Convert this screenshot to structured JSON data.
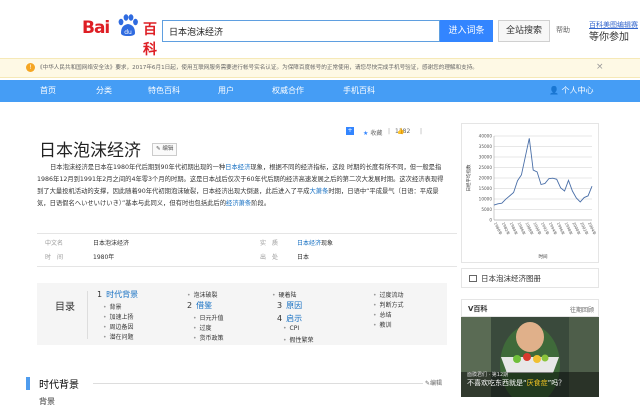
{
  "header": {
    "logo": {
      "bai": "Bai",
      "du": "du",
      "baike": "百科"
    },
    "search_value": "日本泡沫经济",
    "enter_button": "进入词条",
    "search_button": "全站搜索",
    "help": "帮助",
    "promo_line1": "百科美图编辑赛",
    "promo_line2": "等你参加"
  },
  "notice": {
    "text": "《中华人民共和国网络安全法》要求，2017年6月1日起，使用互联网服务需要进行帐号实名认证。为保障百度帐号的正常使用，请您尽快完成手机号验证，感谢您的理解和支持。",
    "close": "×"
  },
  "nav": [
    "首页",
    "分类",
    "特色百科",
    "用户",
    "权威合作",
    "手机百科"
  ],
  "nav_user": "个人中心",
  "article": {
    "title": "日本泡沫经济",
    "edit": "编辑",
    "tools": {
      "favorite": "收藏",
      "favorite_count": "1282",
      "like_count": "16",
      "share_count": "71"
    },
    "paragraph": {
      "p1": "日本泡沫经济是日本在1980年代后期到90年代初期出现的一种",
      "link1": "日本经济",
      "p2": "现象，根据不同的经济指标，这段 时期的长度有所不同，但一般是指1986年12月到1991年2月之间的4年零3个月的时期。这是日本战后仅次于60年代后期的经济高速发展之后的第二次大发展时期。这次经济表现得到了大量投机活动的支撑，因此随着90年代初期泡沫破裂，日本经济出现大倒退，此后进入了平成",
      "link2": "大萧条",
      "p3": "时期，日语中“平成景气（日语：平成景気，日语假名ヘいせいけいき）”基本与此同义，但有时也包括此后的",
      "link3": "经济萧条",
      "p4": "阶段。"
    },
    "infobox": {
      "k1": "中文名",
      "v1": "日本泡沫经济",
      "k2": "时　间",
      "v2": "1980年",
      "k3": "实　质",
      "v3_link": "日本经济",
      "v3_rest": "现象",
      "k4": "出　处",
      "v4": "日本"
    },
    "toc": {
      "title": "目录",
      "sections": [
        {
          "num": "1",
          "label": "时代背景"
        },
        {
          "num": "2",
          "label": "借鉴"
        },
        {
          "num": "3",
          "label": "原因"
        },
        {
          "num": "4",
          "label": "启示"
        }
      ],
      "sub": [
        "背景",
        "加速上扬",
        "周边备因",
        "潜在问题",
        "泡沫破裂",
        "日元升值",
        "过度",
        "货币政策",
        "硬着陆",
        "CPI",
        "假性繁荣",
        "过度流动",
        "判断方式",
        "总结",
        "教训"
      ]
    },
    "section_title": "时代背景",
    "section_edit": "编辑",
    "section_cut": "背景"
  },
  "sidebar": {
    "caption": "日本泡沫经济图册",
    "v_title": "V百科",
    "v_more": "往期回顾",
    "video_small": "面膜君们 · 第12期",
    "video_caption_a": "不喜欢吃东西就是“",
    "video_caption_b": "厌食症",
    "video_caption_c": "”吗？"
  },
  "chart_data": {
    "type": "line",
    "title": "",
    "xlabel": "时间",
    "ylabel": "日经平均指数",
    "ylim": [
      0,
      40000
    ],
    "yticks": [
      0,
      5000,
      10000,
      15000,
      20000,
      25000,
      30000,
      35000,
      40000
    ],
    "x": [
      1980,
      1981,
      1982,
      1983,
      1984,
      1985,
      1986,
      1987,
      1988,
      1989,
      1990,
      1991,
      1992,
      1993,
      1994,
      1995,
      1996,
      1997,
      1998,
      1999,
      2000,
      2001,
      2002,
      2003,
      2004,
      2005
    ],
    "xticks": [
      "1980年",
      "1982年",
      "1984年",
      "1986年",
      "1988年",
      "1990年",
      "1992年",
      "1994年",
      "1996年",
      "1998年",
      "2000年",
      "2002年",
      "2004年"
    ],
    "series": [
      {
        "values": [
          7100,
          7700,
          8000,
          9900,
          11500,
          13100,
          18700,
          21500,
          30200,
          38900,
          23800,
          22900,
          16900,
          17400,
          19700,
          19900,
          19400,
          15300,
          13800,
          18900,
          13800,
          10500,
          8600,
          10700,
          11500,
          16100
        ]
      }
    ],
    "grid": true,
    "line_color": "#4a6fa8"
  }
}
